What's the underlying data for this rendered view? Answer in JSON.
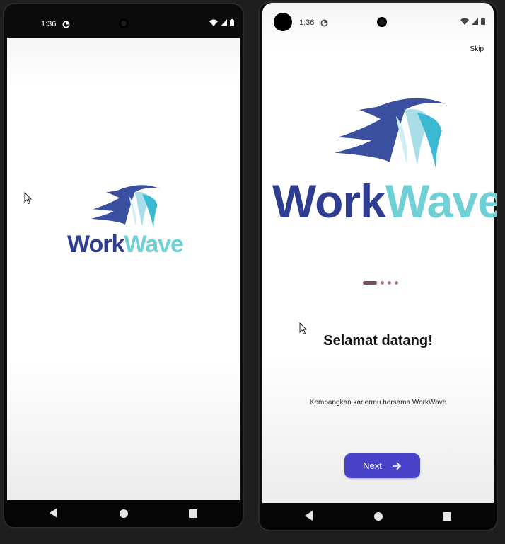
{
  "left_phone": {
    "status_time": "1:36",
    "logo": {
      "word_part1": "Work",
      "word_part2": "Wave"
    }
  },
  "right_phone": {
    "status_time": "1:36",
    "skip_label": "Skip",
    "logo": {
      "word_part1": "Work",
      "word_part2": "Wave"
    },
    "page_indicator": {
      "total": 4,
      "active_index": 0
    },
    "title": "Selamat datang!",
    "subtitle": "Kembangkan kariermu bersama WorkWave",
    "next_label": "Next"
  },
  "colors": {
    "brand_dark_blue": "#2e3d8f",
    "brand_light_cyan": "#6fd0d6",
    "button": "#4742c8",
    "indicator_active": "#7a4e54",
    "indicator_inactive": "#b07f86"
  },
  "icons": {
    "status_left": [
      "data-saver-icon"
    ],
    "status_right": [
      "wifi-icon",
      "signal-icon",
      "battery-icon"
    ],
    "next_button": "arrow-right-icon",
    "nav": [
      "back-icon",
      "home-icon",
      "recents-icon"
    ]
  }
}
